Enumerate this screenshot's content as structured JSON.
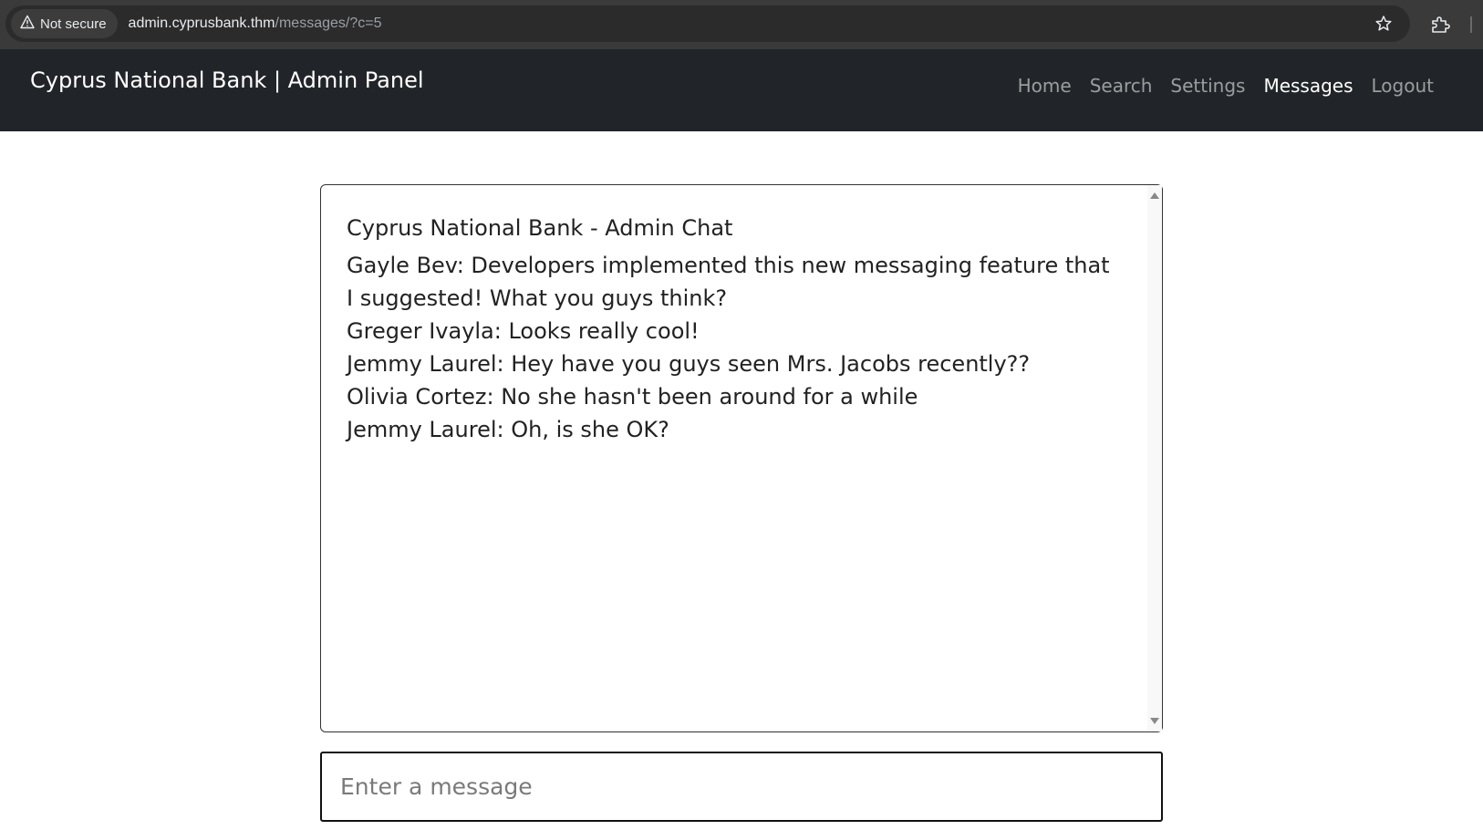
{
  "browser": {
    "security_label": "Not secure",
    "url_host": "admin.cyprusbank.thm",
    "url_path": "/messages/?c=5"
  },
  "navbar": {
    "brand": "Cyprus National Bank | Admin Panel",
    "links": [
      {
        "label": "Home",
        "active": false
      },
      {
        "label": "Search",
        "active": false
      },
      {
        "label": "Settings",
        "active": false
      },
      {
        "label": "Messages",
        "active": true
      },
      {
        "label": "Logout",
        "active": false
      }
    ]
  },
  "chat": {
    "title": "Cyprus National Bank - Admin Chat",
    "messages": [
      "Gayle Bev: Developers implemented this new messaging feature that I suggested! What you guys think?",
      "Greger Ivayla: Looks really cool!",
      "Jemmy Laurel: Hey have you guys seen Mrs. Jacobs recently??",
      "Olivia Cortez: No she hasn't been around for a while",
      "Jemmy Laurel: Oh, is she OK?"
    ]
  },
  "input": {
    "placeholder": "Enter a message",
    "value": ""
  }
}
